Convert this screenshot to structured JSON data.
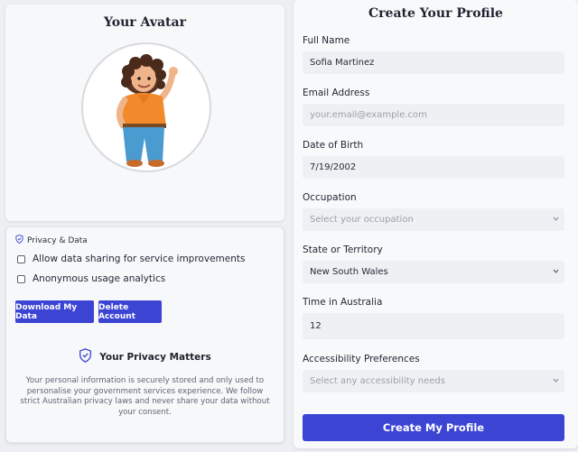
{
  "avatar": {
    "title": "Your Avatar"
  },
  "privacy": {
    "header": "Privacy & Data",
    "options": [
      {
        "label": "Allow data sharing for service improvements",
        "checked": false
      },
      {
        "label": "Anonymous usage analytics",
        "checked": false
      }
    ],
    "download_label": "Download My Data",
    "delete_label": "Delete Account",
    "notice_title": "Your Privacy Matters",
    "notice_text": "Your personal information is securely stored and only used to personalise your government services experience. We follow strict Australian privacy laws and never share your data without your consent."
  },
  "profile": {
    "title": "Create Your Profile",
    "fields": {
      "full_name": {
        "label": "Full Name",
        "value": "Sofia Martinez"
      },
      "email": {
        "label": "Email Address",
        "placeholder": "your.email@example.com"
      },
      "dob": {
        "label": "Date of Birth",
        "value": "7/19/2002"
      },
      "occupation": {
        "label": "Occupation",
        "placeholder": "Select your occupation"
      },
      "state": {
        "label": "State or Territory",
        "value": "New South Wales"
      },
      "time_in_australia": {
        "label": "Time in Australia",
        "value": "12"
      },
      "accessibility": {
        "label": "Accessibility Preferences",
        "placeholder": "Select any accessibility needs"
      }
    },
    "submit_label": "Create My Profile"
  },
  "colors": {
    "accent": "#3c44d4",
    "background": "#eeeff3",
    "field_background": "#eef0f4"
  },
  "icons": [
    "shield-check-icon",
    "chevron-down-icon"
  ]
}
